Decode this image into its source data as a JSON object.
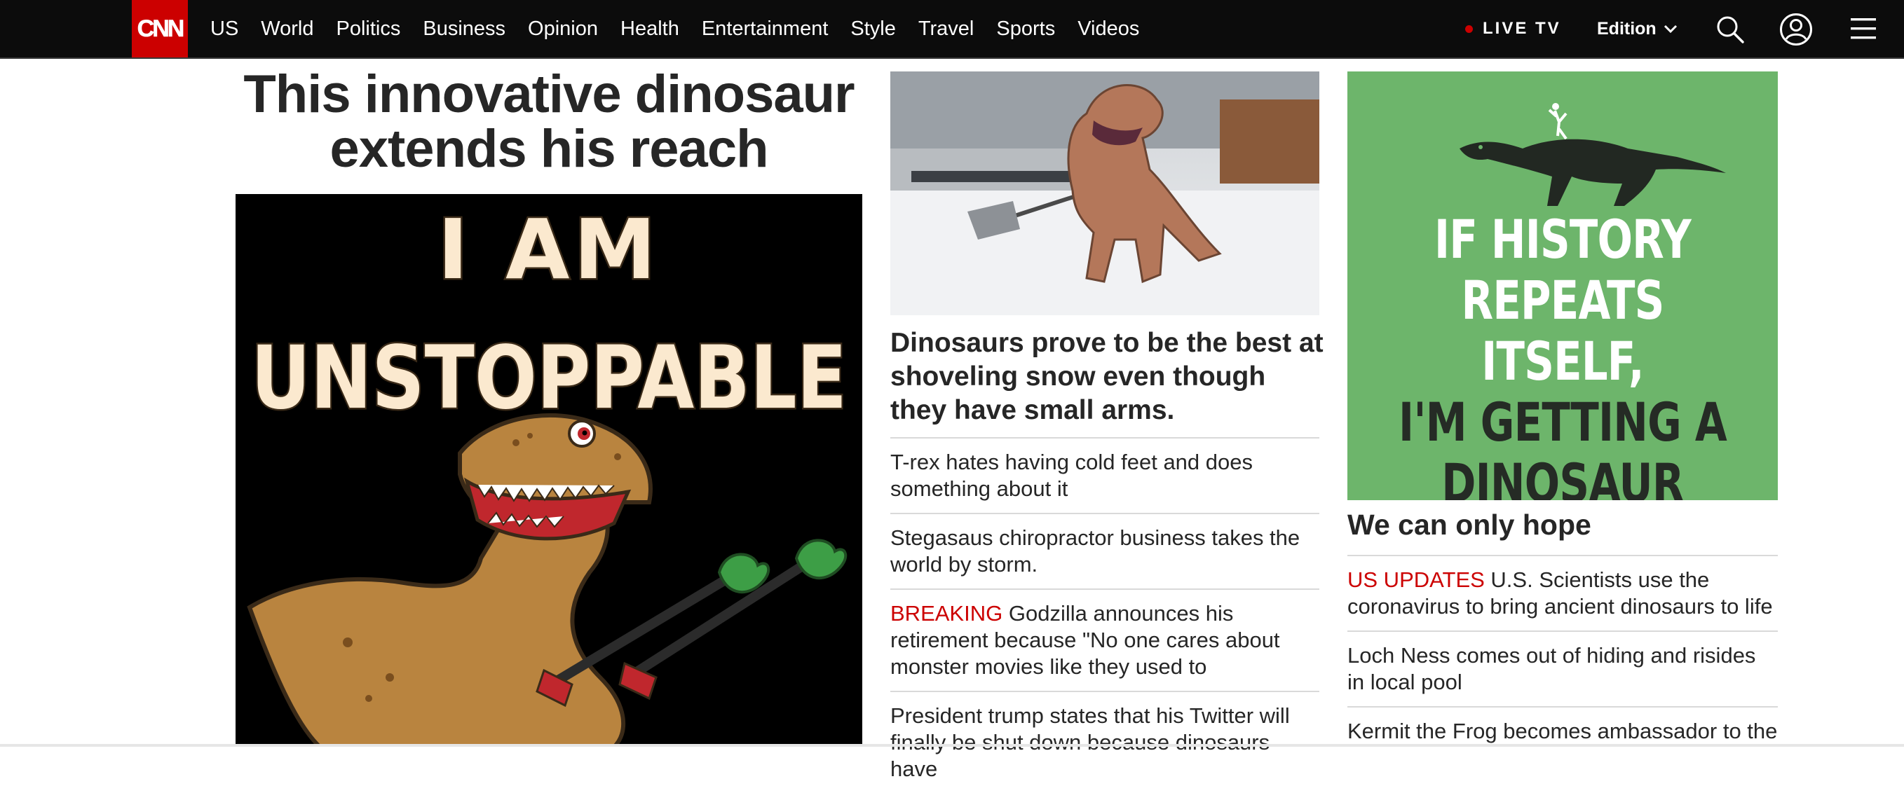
{
  "nav": {
    "logo_text": "CNN",
    "links": [
      "US",
      "World",
      "Politics",
      "Business",
      "Opinion",
      "Health",
      "Entertainment",
      "Style",
      "Travel",
      "Sports",
      "Videos"
    ],
    "live_tv": "LIVE TV",
    "edition": "Edition",
    "icons": [
      "search-icon",
      "account-icon",
      "menu-icon"
    ]
  },
  "hero": {
    "title": "This innovative dinosaur extends his reach",
    "image_text_line1": "I AM",
    "image_text_line2": "UNSTOPPABLE"
  },
  "middle": {
    "headline": "Dinosaurs prove to be the best at shoveling snow even though they have small arms.",
    "stories": [
      {
        "kicker": "",
        "text": "T-rex hates having cold feet and does something about it"
      },
      {
        "kicker": "",
        "text": "Stegasaus chiropractor business takes the world by storm."
      },
      {
        "kicker": "BREAKING",
        "text": "Godzilla announces his retirement because \"No one cares about monster movies like they used to"
      },
      {
        "kicker": "",
        "text": "President trump states that his Twitter will finally be shut down because dinosaurs have"
      }
    ]
  },
  "right": {
    "promo_line1": "IF HISTORY",
    "promo_line2": "REPEATS ITSELF,",
    "promo_line3": "I'M GETTING A",
    "promo_line4": "DINOSAUR",
    "heading": "We can only hope",
    "stories": [
      {
        "kicker": "US UPDATES",
        "text": "U.S. Scientists use the coronavirus to bring ancient dinosaurs to life"
      },
      {
        "kicker": "",
        "text": "Loch Ness comes out of hiding and risides in local pool"
      },
      {
        "kicker": "",
        "text": "Kermit the Frog becomes ambassador to the"
      }
    ]
  },
  "colors": {
    "brand_red": "#cc0000",
    "nav_bg": "#0c0c0c",
    "promo_green": "#6db56b",
    "hero_cream": "#fbe9cf",
    "dino_brown": "#b9843f"
  }
}
